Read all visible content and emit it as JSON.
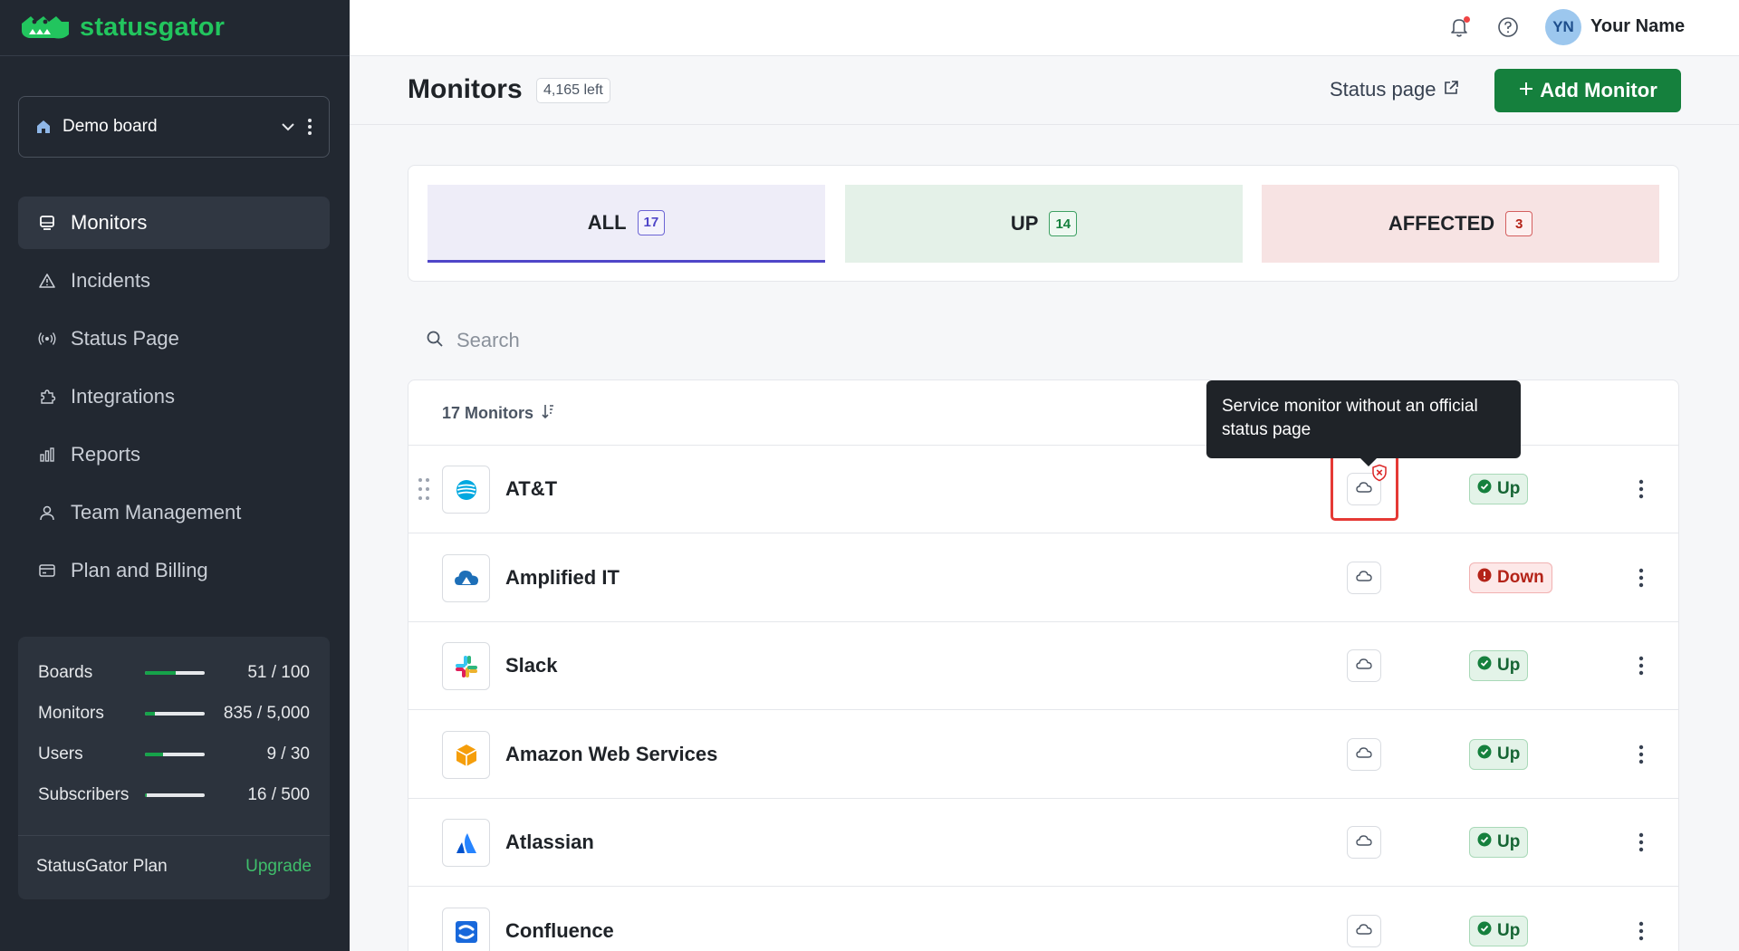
{
  "app": {
    "brand": "statusgator"
  },
  "sidebar": {
    "board_name": "Demo board",
    "nav": [
      {
        "label": "Monitors",
        "icon": "monitor-icon",
        "active": true
      },
      {
        "label": "Incidents",
        "icon": "warning-icon",
        "active": false
      },
      {
        "label": "Status Page",
        "icon": "broadcast-icon",
        "active": false
      },
      {
        "label": "Integrations",
        "icon": "puzzle-icon",
        "active": false
      },
      {
        "label": "Reports",
        "icon": "bar-chart-icon",
        "active": false
      },
      {
        "label": "Team Management",
        "icon": "user-icon",
        "active": false
      },
      {
        "label": "Plan and Billing",
        "icon": "credit-card-icon",
        "active": false
      }
    ],
    "usage": [
      {
        "label": "Boards",
        "value": "51 / 100",
        "fraction": 0.51
      },
      {
        "label": "Monitors",
        "value": "835 / 5,000",
        "fraction": 0.167
      },
      {
        "label": "Users",
        "value": "9 / 30",
        "fraction": 0.3
      },
      {
        "label": "Subscribers",
        "value": "16 / 500",
        "fraction": 0.032
      }
    ],
    "plan_label": "StatusGator Plan",
    "upgrade_label": "Upgrade"
  },
  "topbar": {
    "avatar_initials": "YN",
    "user_name": "Your Name"
  },
  "header": {
    "title": "Monitors",
    "left_badge": "4,165 left",
    "status_page_link": "Status page",
    "add_button": "Add Monitor"
  },
  "tabs": [
    {
      "label": "ALL",
      "count": "17"
    },
    {
      "label": "UP",
      "count": "14"
    },
    {
      "label": "AFFECTED",
      "count": "3"
    }
  ],
  "search": {
    "placeholder": "Search"
  },
  "list": {
    "count_label": "17 Monitors",
    "rows": [
      {
        "name": "AT&T",
        "status": "Up"
      },
      {
        "name": "Amplified IT",
        "status": "Down"
      },
      {
        "name": "Slack",
        "status": "Up"
      },
      {
        "name": "Amazon Web Services",
        "status": "Up"
      },
      {
        "name": "Atlassian",
        "status": "Up"
      },
      {
        "name": "Confluence",
        "status": "Up"
      }
    ]
  },
  "tooltip": {
    "text": "Service monitor without an official status page"
  },
  "colors": {
    "brand_green": "#15803d",
    "sidebar_bg": "#222831",
    "accent_purple": "#4f46c8",
    "down_red": "#b42318"
  }
}
